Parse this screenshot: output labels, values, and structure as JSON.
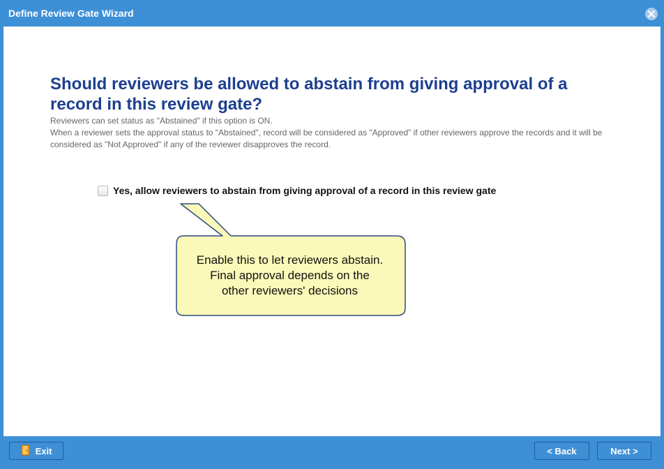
{
  "window": {
    "title": "Define Review Gate Wizard"
  },
  "question": {
    "heading": "Should reviewers be allowed to abstain from giving approval of a record in this review gate?",
    "line1": "Reviewers can set status as \"Abstained\" if this option is ON.",
    "line2": "When a reviewer sets the approval status to \"Abstained\", record will be considered as \"Approved\" if other reviewers approve the records and it will be considered as \"Not Approved\" if any of the reviewer disapproves the record."
  },
  "option": {
    "label": "Yes, allow reviewers to abstain from giving approval of a record in this review gate",
    "checked": false
  },
  "callout": {
    "text": "Enable this to let reviewers abstain.\nFinal approval depends on the\nother reviewers' decisions"
  },
  "footer": {
    "exit_label": "Exit",
    "back_label": "< Back",
    "next_label": "Next >"
  },
  "colors": {
    "accent": "#3d8fd6",
    "heading": "#1d3f8f",
    "callout_fill": "#fbf9b9",
    "callout_border": "#2b4c7e"
  },
  "icons": {
    "close": "close-icon",
    "exit": "exit-door-icon"
  }
}
